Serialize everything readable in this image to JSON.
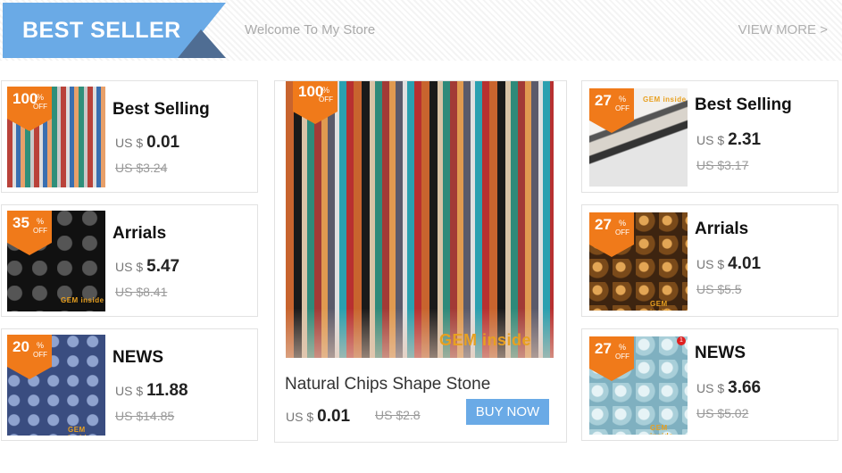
{
  "header": {
    "banner_label": "BEST SELLER",
    "welcome": "Welcome To My Store",
    "view_more": "VIEW MORE >"
  },
  "colors": {
    "banner_blue": "#6aaae6",
    "badge_orange": "#f07a1a",
    "button_blue": "#6aaae6"
  },
  "badge": {
    "percent_symbol": "%",
    "off_label": "OFF"
  },
  "currency": "US $",
  "left_cards": [
    {
      "discount": "100",
      "title": "Best Selling",
      "price": "0.01",
      "old_price": "US $3.24"
    },
    {
      "discount": "35",
      "title": "Arrials",
      "price": "5.47",
      "old_price": "US $8.41"
    },
    {
      "discount": "20",
      "title": "NEWS",
      "price": "11.88",
      "old_price": "US $14.85"
    }
  ],
  "featured": {
    "discount": "100",
    "title": "Natural Chips Shape Stone",
    "price": "0.01",
    "old_price": "US $2.8",
    "buy_label": "BUY NOW",
    "logo_text": "GEM inside"
  },
  "right_cards": [
    {
      "discount": "27",
      "title": "Best Selling",
      "price": "2.31",
      "old_price": "US $3.17"
    },
    {
      "discount": "27",
      "title": "Arrials",
      "price": "4.01",
      "old_price": "US $5.5"
    },
    {
      "discount": "27",
      "title": "NEWS",
      "price": "3.66",
      "old_price": "US $5.02"
    }
  ],
  "thumb_logo": "GEM inside",
  "notification_count": "1"
}
